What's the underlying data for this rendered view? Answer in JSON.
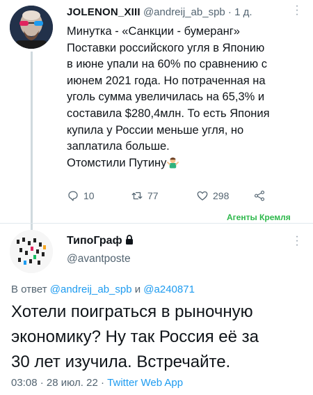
{
  "tweet": {
    "display_name": "JOLENON_XIII",
    "handle": "@andreij_ab_spb",
    "separator": "·",
    "time": "1 д.",
    "body_lines": [
      "Минутка - «Санкции - бумеранг»",
      "Поставки российского угля в Японию",
      "в июне упали на 60% по сравнению с",
      "июнем 2021 года. Но потраченная на",
      "уголь сумма увеличилась на 65,3% и",
      "составила $280,4млн. То есть Япония",
      "купила у России меньше угля, но",
      "заплатила больше.",
      "Отомстили Путину"
    ],
    "emoji": "shrug-emoji",
    "actions": {
      "replies": "10",
      "retweets": "77",
      "likes": "298"
    }
  },
  "watermark": "Агенты Кремля",
  "reply": {
    "display_name": "ТипоГраф",
    "handle": "@avantposte",
    "reply_prefix": "В ответ",
    "reply_to_1": "@andreij_ab_spb",
    "reply_joiner": "и",
    "reply_to_2": "@a240871",
    "body_lines": [
      "Хотели поиграться в рыночную",
      "экономику? Ну так Россия её за",
      "30 лет изучила. Встречайте."
    ],
    "time": "03:08",
    "date_sep": "·",
    "date": "28 июл. 22",
    "source_sep": "·",
    "source": "Twitter Web App"
  },
  "colors": {
    "accent": "#1d9bf0",
    "muted": "#536471",
    "watermark": "#2db84b"
  },
  "icons": [
    "more-icon",
    "reply-icon",
    "retweet-icon",
    "like-icon",
    "share-icon",
    "lock-icon"
  ]
}
